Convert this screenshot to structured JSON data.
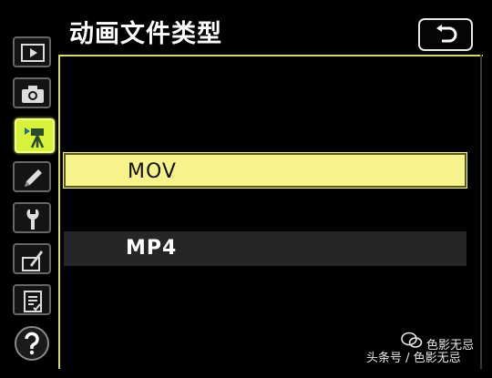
{
  "header": {
    "title": "动画文件类型",
    "back_icon": "return-arrow-icon"
  },
  "sidebar": {
    "items": [
      {
        "icon": "playback-icon",
        "active": false
      },
      {
        "icon": "camera-icon",
        "active": false
      },
      {
        "icon": "movie-camera-icon",
        "active": true
      },
      {
        "icon": "pencil-icon",
        "active": false
      },
      {
        "icon": "wrench-icon",
        "active": false
      },
      {
        "icon": "retouch-icon",
        "active": false
      },
      {
        "icon": "recent-settings-icon",
        "active": false
      },
      {
        "icon": "help-icon",
        "active": false
      }
    ]
  },
  "menu": {
    "options": [
      {
        "label": "MOV",
        "selected": true
      },
      {
        "label": "MP4",
        "selected": false
      }
    ]
  },
  "watermark": {
    "line1": "色影无忌",
    "line2": "头条号 / 色影无忌"
  },
  "colors": {
    "highlight": "#f8f28c",
    "active_tab": "#d8f23c",
    "row": "#262626"
  }
}
